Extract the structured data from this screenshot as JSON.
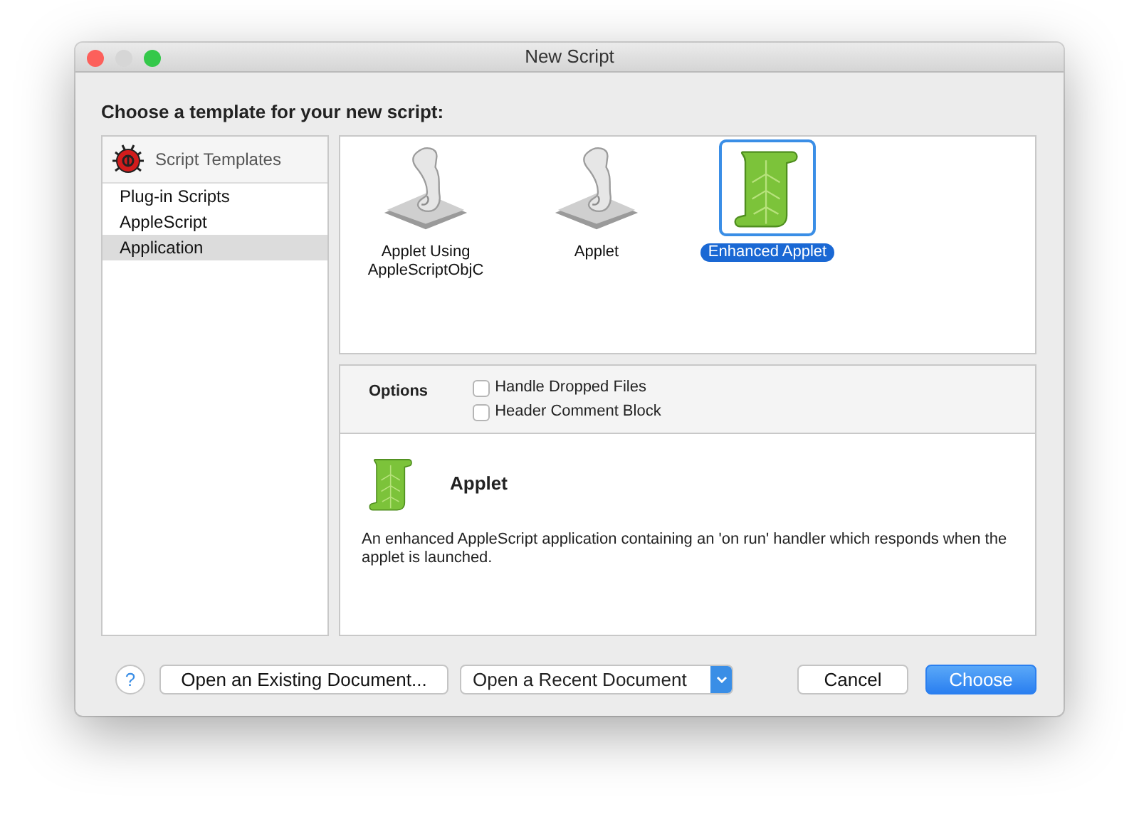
{
  "window": {
    "title": "New Script"
  },
  "heading": "Choose a template for your new script:",
  "sidebar": {
    "header": "Script Templates",
    "items": [
      {
        "label": "Plug-in Scripts",
        "selected": false
      },
      {
        "label": "AppleScript",
        "selected": false
      },
      {
        "label": "Application",
        "selected": true
      }
    ]
  },
  "templates": [
    {
      "label": "Applet Using AppleScriptObjC",
      "kind": "plain",
      "selected": false
    },
    {
      "label": "Applet",
      "kind": "plain",
      "selected": false
    },
    {
      "label": "Enhanced Applet",
      "kind": "enhanced",
      "selected": true
    }
  ],
  "options": {
    "label": "Options",
    "checkboxes": [
      {
        "label": "Handle Dropped Files",
        "checked": false
      },
      {
        "label": "Header Comment Block",
        "checked": false
      }
    ]
  },
  "detail": {
    "title": "Applet",
    "kind": "enhanced",
    "description": "An enhanced AppleScript application containing an 'on run' handler which responds when the applet is launched."
  },
  "footer": {
    "help": "?",
    "open_existing": "Open an Existing Document...",
    "open_recent": "Open a Recent Document",
    "cancel": "Cancel",
    "choose": "Choose"
  }
}
